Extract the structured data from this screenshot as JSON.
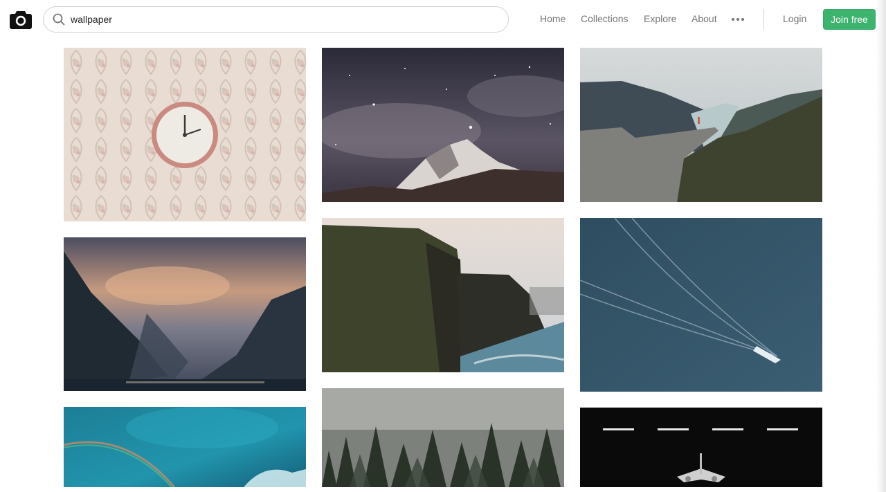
{
  "header": {
    "logo_icon": "camera-icon",
    "search": {
      "icon": "search-icon",
      "value": "wallpaper"
    },
    "nav": [
      {
        "label": "Home"
      },
      {
        "label": "Collections"
      },
      {
        "label": "Explore"
      },
      {
        "label": "About"
      }
    ],
    "more_icon": "more-horizontal-icon",
    "login_label": "Login",
    "join_label": "Join free",
    "join_color": "#3cb46e"
  },
  "photos": [
    {
      "subject": "vintage clock on floral wallpaper"
    },
    {
      "subject": "snowy mountain under starry sky"
    },
    {
      "subject": "cliff over fjord with person standing"
    },
    {
      "subject": "misty fjord mountains at sunset"
    },
    {
      "subject": "green coastal cliffs by the sea"
    },
    {
      "subject": "aerial view of boat wake on water"
    },
    {
      "subject": "aerial turquoise water with rainbow"
    },
    {
      "subject": "foggy pine forest"
    },
    {
      "subject": "airplane in dark hangar"
    }
  ]
}
